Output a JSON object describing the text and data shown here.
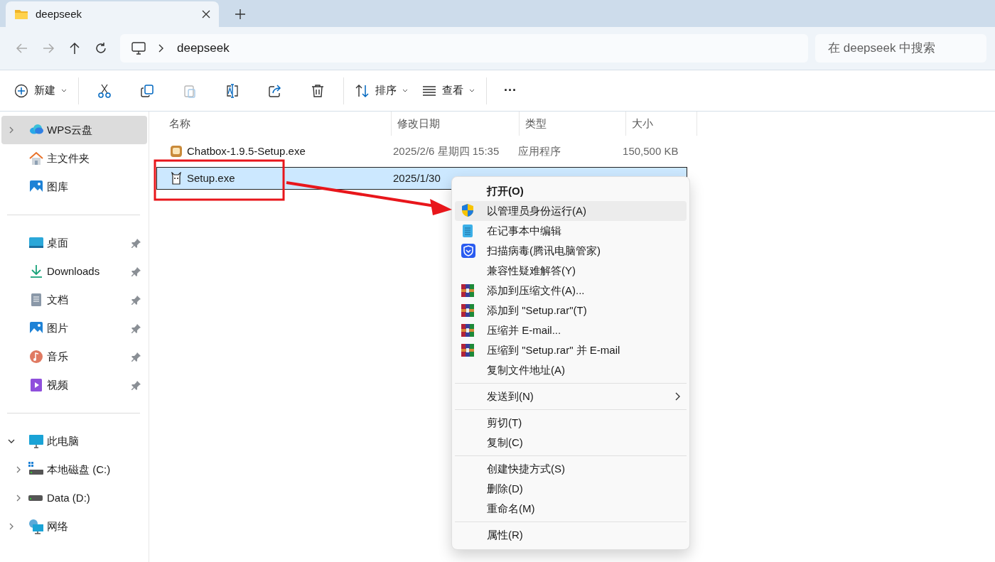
{
  "tab": {
    "title": "deepseek",
    "selected": true
  },
  "address": {
    "path": [
      "deepseek"
    ]
  },
  "search": {
    "placeholder": "在 deepseek 中搜索"
  },
  "toolbar": [
    {
      "kind": "new",
      "label": "新建",
      "dropdown": true,
      "disabled": false
    },
    {
      "kind": "cut",
      "disabled": false
    },
    {
      "kind": "copy",
      "disabled": false
    },
    {
      "kind": "paste",
      "disabled": true
    },
    {
      "kind": "rename",
      "disabled": false
    },
    {
      "kind": "share",
      "disabled": false
    },
    {
      "kind": "delete",
      "disabled": false
    },
    {
      "kind": "sort",
      "label": "排序",
      "dropdown": true,
      "disabled": false
    },
    {
      "kind": "view",
      "label": "查看",
      "dropdown": true,
      "disabled": false
    },
    {
      "kind": "more",
      "label": "···",
      "disabled": false
    }
  ],
  "sidebar": {
    "groups": [
      [
        {
          "label": "WPS云盘",
          "kind": "cloud",
          "expanded": false,
          "pinned": false,
          "selected": true
        },
        {
          "label": "主文件夹",
          "kind": "home",
          "pinned": false,
          "selected": false
        },
        {
          "label": "图库",
          "kind": "gallery",
          "pinned": false,
          "selected": false
        }
      ],
      [
        {
          "label": "桌面",
          "kind": "desktop",
          "pinned": true,
          "selected": false
        },
        {
          "label": "Downloads",
          "kind": "download",
          "pinned": true,
          "selected": false
        },
        {
          "label": "文档",
          "kind": "document",
          "pinned": true,
          "selected": false
        },
        {
          "label": "图片",
          "kind": "gallery",
          "pinned": true,
          "selected": false
        },
        {
          "label": "音乐",
          "kind": "music",
          "pinned": true,
          "selected": false
        },
        {
          "label": "视频",
          "kind": "video",
          "pinned": true,
          "selected": false
        }
      ],
      [
        {
          "label": "此电脑",
          "kind": "pc",
          "expanded": true,
          "pinned": false,
          "selected": false,
          "children": [
            {
              "label": "本地磁盘 (C:)",
              "kind": "sysdrive",
              "expanded": false,
              "pinned": false,
              "selected": false
            },
            {
              "label": "Data (D:)",
              "kind": "drive",
              "expanded": false,
              "pinned": false,
              "selected": false
            }
          ]
        },
        {
          "label": "网络",
          "kind": "network",
          "expanded": false,
          "pinned": false,
          "selected": false
        }
      ]
    ]
  },
  "table": {
    "columns": [
      "名称",
      "修改日期",
      "类型",
      "大小"
    ],
    "rows": [
      {
        "kind": "chatbox",
        "name": "Chatbox-1.9.5-Setup.exe",
        "date": "2025/2/6 星期四 15:35",
        "type": "应用程序",
        "size": "150,500 KB",
        "selected": false
      },
      {
        "kind": "llama",
        "name": "Setup.exe",
        "date": "2025/1/30",
        "selected": true
      }
    ]
  },
  "context_menu": {
    "groups": [
      [
        {
          "label": "打开(O)",
          "kind": "plain",
          "default": true,
          "highlighted": false
        },
        {
          "label": "以管理员身份运行(A)",
          "kind": "shield",
          "default": false,
          "highlighted": true
        },
        {
          "label": "在记事本中编辑",
          "kind": "notepad",
          "default": false,
          "highlighted": false
        },
        {
          "label": "扫描病毒(腾讯电脑管家)",
          "kind": "antivirus",
          "default": false,
          "highlighted": false
        },
        {
          "label": "兼容性疑难解答(Y)",
          "kind": "plain",
          "default": false,
          "highlighted": false
        },
        {
          "label": "添加到压缩文件(A)...",
          "kind": "archive",
          "default": false,
          "highlighted": false
        },
        {
          "label": "添加到 \"Setup.rar\"(T)",
          "kind": "archive",
          "default": false,
          "highlighted": false
        },
        {
          "label": "压缩并 E-mail...",
          "kind": "archive",
          "default": false,
          "highlighted": false
        },
        {
          "label": "压缩到 \"Setup.rar\" 并 E-mail",
          "kind": "archive",
          "default": false,
          "highlighted": false
        },
        {
          "label": "复制文件地址(A)",
          "kind": "plain",
          "default": false,
          "highlighted": false
        }
      ],
      [
        {
          "label": "发送到(N)",
          "kind": "submenu",
          "default": false,
          "highlighted": false
        }
      ],
      [
        {
          "label": "剪切(T)",
          "kind": "plain",
          "default": false,
          "highlighted": false
        },
        {
          "label": "复制(C)",
          "kind": "plain",
          "default": false,
          "highlighted": false
        }
      ],
      [
        {
          "label": "创建快捷方式(S)",
          "kind": "plain",
          "default": false,
          "highlighted": false
        },
        {
          "label": "删除(D)",
          "kind": "plain",
          "default": false,
          "highlighted": false
        },
        {
          "label": "重命名(M)",
          "kind": "plain",
          "default": false,
          "highlighted": false
        }
      ],
      [
        {
          "label": "属性(R)",
          "kind": "plain",
          "default": false,
          "highlighted": false
        }
      ]
    ]
  }
}
